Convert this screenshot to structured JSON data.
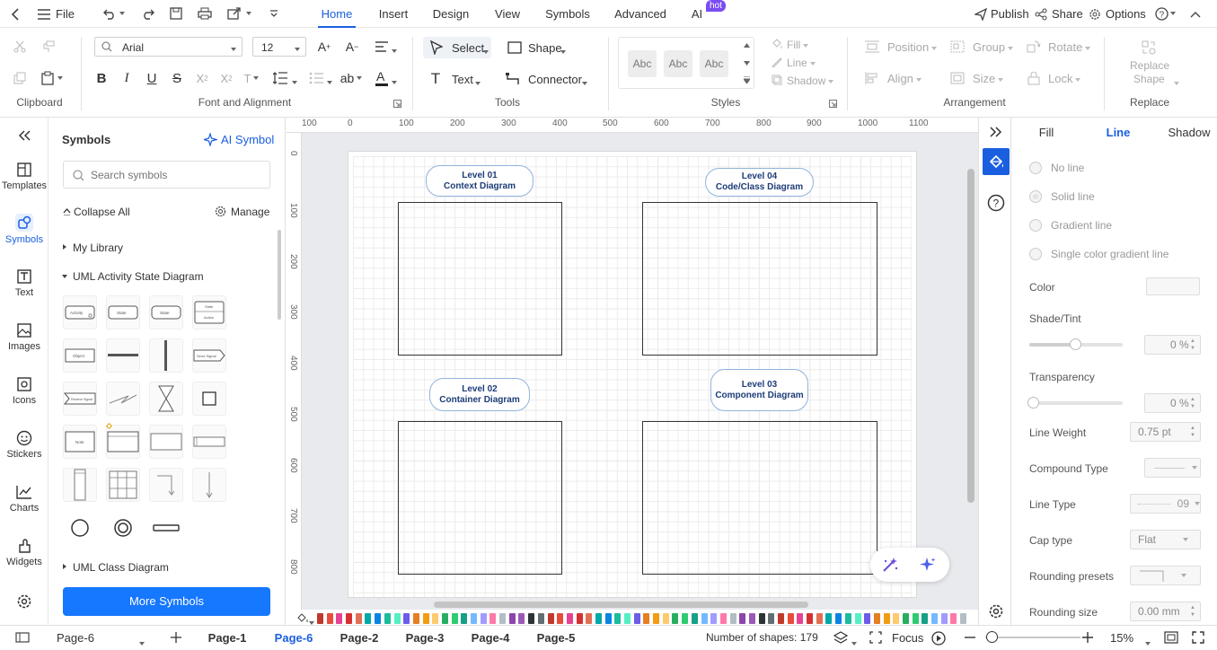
{
  "menubar": {
    "file": "File",
    "tabs": [
      {
        "label": "Home"
      },
      {
        "label": "Insert"
      },
      {
        "label": "Design"
      },
      {
        "label": "View"
      },
      {
        "label": "Symbols"
      },
      {
        "label": "Advanced"
      },
      {
        "label": "AI"
      }
    ],
    "hot_badge": "hot",
    "publish": "Publish",
    "share": "Share",
    "options": "Options"
  },
  "ribbon": {
    "groups": {
      "clipboard": "Clipboard",
      "font": "Font and Alignment",
      "tools": "Tools",
      "styles": "Styles",
      "arrangement": "Arrangement",
      "replace": "Replace"
    },
    "font_name": "Arial",
    "font_size": "12",
    "select": "Select",
    "shape": "Shape",
    "text": "Text",
    "connector": "Connector",
    "style_swatch": "Abc",
    "fill": "Fill",
    "line": "Line",
    "shadow": "Shadow",
    "position": "Position",
    "group": "Group",
    "rotate": "Rotate",
    "align": "Align",
    "size": "Size",
    "lock": "Lock",
    "replace_shape_1": "Replace",
    "replace_shape_2": "Shape"
  },
  "rail": [
    {
      "label": "Templates"
    },
    {
      "label": "Symbols"
    },
    {
      "label": "Text"
    },
    {
      "label": "Images"
    },
    {
      "label": "Icons"
    },
    {
      "label": "Stickers"
    },
    {
      "label": "Charts"
    },
    {
      "label": "Widgets"
    }
  ],
  "symbols": {
    "title": "Symbols",
    "ai_symbol": "AI Symbol",
    "search_placeholder": "Search symbols",
    "collapse_all": "Collapse All",
    "manage": "Manage",
    "my_library": "My Library",
    "section_activity": "UML Activity State Diagram",
    "section_class": "UML Class Diagram",
    "more": "More Symbols",
    "cells": {
      "activity": "Activity",
      "state": "State",
      "object": "Object",
      "send_signal": "Send Signal",
      "receive_signal": "Receive Signal",
      "state_action": "Action",
      "note": "Note"
    }
  },
  "rulers": {
    "top": [
      "100",
      "0",
      "100",
      "200",
      "300",
      "400",
      "500",
      "600",
      "700",
      "800",
      "900",
      "1000",
      "1100"
    ],
    "left": [
      "0",
      "100",
      "200",
      "300",
      "400",
      "500",
      "600",
      "700",
      "800"
    ]
  },
  "diagram": {
    "level1_a": "Level 01",
    "level1_b": "Context Diagram",
    "level4_a": "Level 04",
    "level4_b": "Code/Class Diagram",
    "level2_a": "Level 02",
    "level2_b": "Container Diagram",
    "level3_a": "Level 03",
    "level3_b": "Component Diagram"
  },
  "props": {
    "tabs": [
      {
        "label": "Fill"
      },
      {
        "label": "Line"
      },
      {
        "label": "Shadow"
      }
    ],
    "no_line": "No line",
    "solid_line": "Solid line",
    "gradient_line": "Gradient line",
    "single_gradient": "Single color gradient line",
    "color": "Color",
    "shade": "Shade/Tint",
    "shade_val": "0 %",
    "transparency": "Transparency",
    "transparency_val": "0 %",
    "line_weight": "Line Weight",
    "line_weight_val": "0.75 pt",
    "compound": "Compound Type",
    "line_type": "Line Type",
    "line_type_val": "09",
    "cap_type": "Cap type",
    "cap_val": "Flat",
    "rounding_presets": "Rounding presets",
    "rounding_size": "Rounding size",
    "rounding_size_val": "0.00 mm"
  },
  "status": {
    "page_select": "Page-6",
    "pages": [
      {
        "label": "Page-1"
      },
      {
        "label": "Page-6"
      },
      {
        "label": "Page-2"
      },
      {
        "label": "Page-3"
      },
      {
        "label": "Page-4"
      },
      {
        "label": "Page-5"
      }
    ],
    "shapes": "Number of shapes: 179",
    "focus": "Focus",
    "zoom": "15%"
  },
  "colors": {
    "accent": "#1a5fe0",
    "pill_border": "#8fb4dc",
    "button_blue": "#1677ff"
  }
}
